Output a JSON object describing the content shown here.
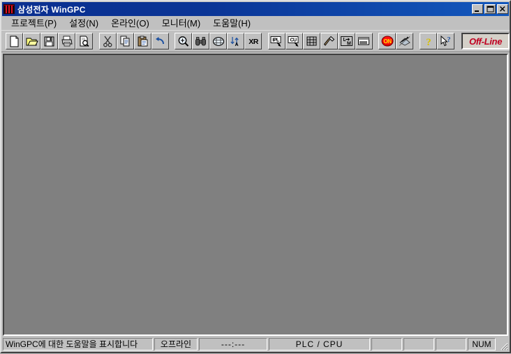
{
  "window": {
    "title": "삼성전자 WinGPC",
    "icon": "wingpc-logo-icon",
    "caption_buttons": [
      {
        "name": "minimize-button",
        "label": "Minimize"
      },
      {
        "name": "maximize-button",
        "label": "Maximize"
      },
      {
        "name": "close-button",
        "label": "Close"
      }
    ]
  },
  "menu": {
    "items": [
      {
        "label": "프로젝트(P)",
        "text": "프로젝트(",
        "accel": "P",
        "tail": ")",
        "name": "menu-project"
      },
      {
        "label": "설정(N)",
        "text": "설정(",
        "accel": "N",
        "tail": ")",
        "name": "menu-settings"
      },
      {
        "label": "온라인(O)",
        "text": "온라인(",
        "accel": "O",
        "tail": ")",
        "name": "menu-online"
      },
      {
        "label": "모니터(M)",
        "text": "모니터(",
        "accel": "M",
        "tail": ")",
        "name": "menu-monitor"
      },
      {
        "label": "도움말(H)",
        "text": "도움말(",
        "accel": "H",
        "tail": ")",
        "name": "menu-help"
      }
    ]
  },
  "toolbar": {
    "groups": [
      {
        "buttons": [
          {
            "icon": "new-document-icon",
            "tooltip": "새 프로젝트"
          },
          {
            "icon": "open-folder-icon",
            "tooltip": "열기"
          },
          {
            "icon": "save-disk-icon",
            "tooltip": "저장"
          },
          {
            "icon": "print-icon",
            "tooltip": "인쇄"
          },
          {
            "icon": "print-preview-icon",
            "tooltip": "인쇄 미리보기"
          }
        ]
      },
      {
        "buttons": [
          {
            "icon": "cut-scissors-icon",
            "tooltip": "잘라내기"
          },
          {
            "icon": "copy-icon",
            "tooltip": "복사"
          },
          {
            "icon": "paste-icon",
            "tooltip": "붙여넣기"
          },
          {
            "icon": "undo-arrow-icon",
            "tooltip": "실행취소"
          }
        ]
      },
      {
        "buttons": [
          {
            "icon": "zoom-magnifier-icon",
            "tooltip": "확대"
          },
          {
            "icon": "binoculars-find-icon",
            "tooltip": "찾기"
          },
          {
            "icon": "grid-table-icon",
            "tooltip": "테이블"
          },
          {
            "icon": "replace-text-icon",
            "label": "A",
            "tooltip": "바꾸기"
          },
          {
            "icon": "xr-label-icon",
            "label": "XR",
            "tooltip": "XR"
          }
        ]
      },
      {
        "buttons": [
          {
            "icon": "ipl-download-icon",
            "label": "IPL",
            "tooltip": "IPL"
          },
          {
            "icon": "cu-download-icon",
            "label": "CU",
            "tooltip": "CU"
          },
          {
            "icon": "ladder-grid-icon",
            "tooltip": "래더"
          },
          {
            "icon": "hammer-build-icon",
            "tooltip": "빌드"
          },
          {
            "icon": "lm-convert-icon",
            "label": "L→M",
            "tooltip": "변환"
          },
          {
            "icon": "window-monitor-icon",
            "tooltip": "모니터 창"
          }
        ]
      },
      {
        "buttons": [
          {
            "icon": "on-power-icon",
            "label": "ON",
            "tooltip": "접속"
          },
          {
            "icon": "transfer-icon",
            "tooltip": "전송"
          }
        ]
      },
      {
        "buttons": [
          {
            "icon": "help-question-icon",
            "tooltip": "도움말"
          },
          {
            "icon": "help-cursor-icon",
            "tooltip": "상황별 도움말"
          }
        ]
      }
    ],
    "offline_indicator": {
      "label": "Off-Line",
      "color": "#c00020"
    }
  },
  "client": {
    "background_color": "#808080"
  },
  "status_bar": {
    "message": "WinGPC에 대한 도움말을 표시합니다",
    "mode": "오프라인",
    "time": "---:---",
    "plc_cpu": "PLC / CPU",
    "blank1": "",
    "blank2": "",
    "blank3": "",
    "num_lock": "NUM"
  }
}
